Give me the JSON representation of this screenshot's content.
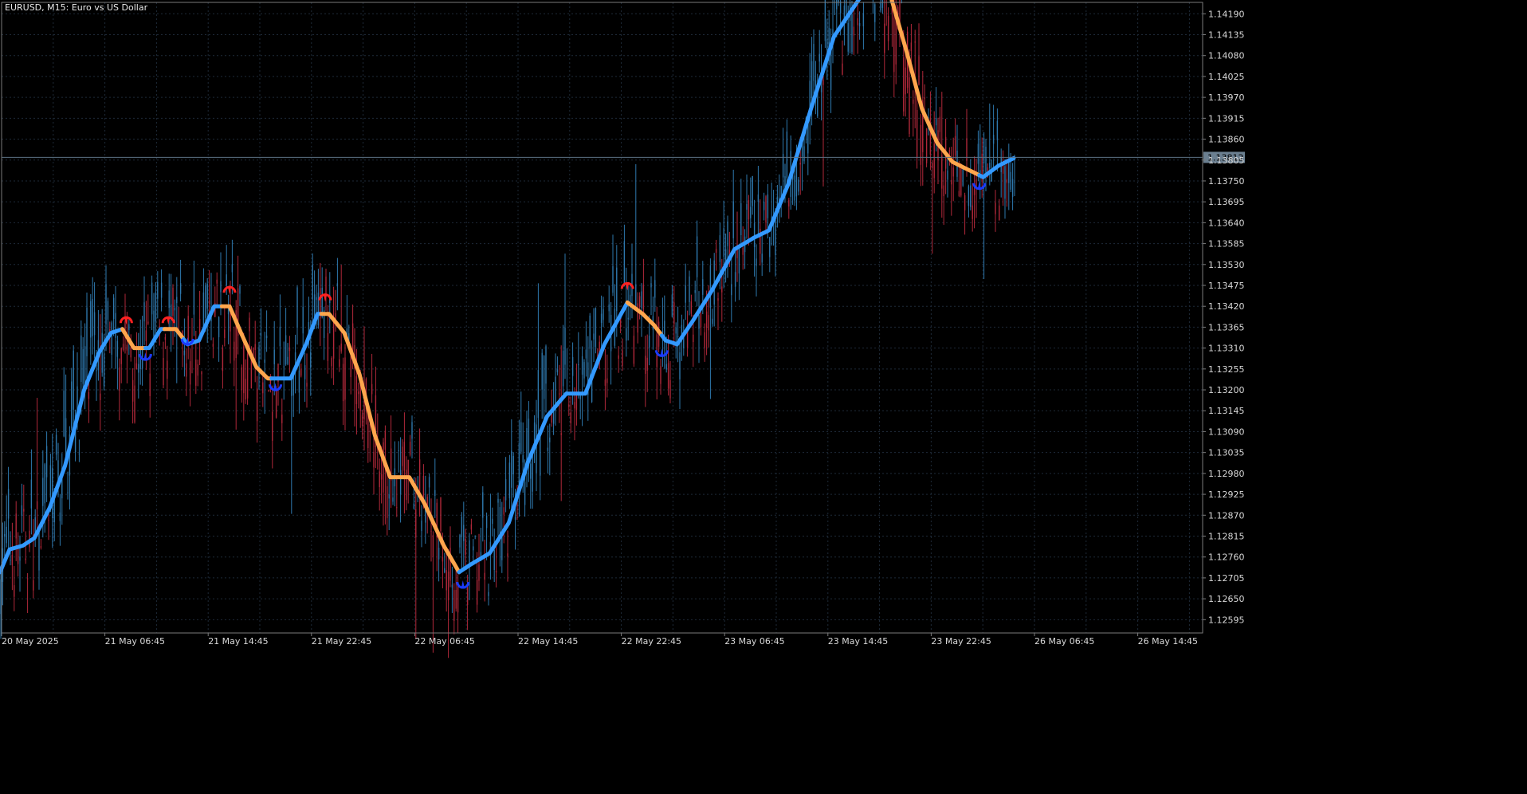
{
  "window": {
    "title": "EURUSD, M15:  Euro vs US Dollar"
  },
  "colors": {
    "background": "#000000",
    "grid": "#1e2a38",
    "frame": "#7a7a7a",
    "bull_candle": "#2e78ad",
    "bear_candle": "#b0283a",
    "trend_up": "#3399ff",
    "trend_down": "#ffa64d",
    "signal_buy": "#1a3cff",
    "signal_sell": "#ff2222",
    "bid_line": "#5c7285",
    "price_label_bg": "#6b7f90",
    "text": "#d9d9d9"
  },
  "chart_data": {
    "type": "candlestick",
    "symbol": "EURUSD",
    "timeframe": "M15",
    "ylim": [
      1.1256,
      1.1422
    ],
    "yticks": [
      1.12595,
      1.1265,
      1.12705,
      1.1276,
      1.12815,
      1.1287,
      1.12925,
      1.1298,
      1.13035,
      1.1309,
      1.13145,
      1.132,
      1.13255,
      1.1331,
      1.13365,
      1.1342,
      1.13475,
      1.1353,
      1.13585,
      1.1364,
      1.13695,
      1.1375,
      1.13805,
      1.1386,
      1.13915,
      1.1397,
      1.14025,
      1.1408,
      1.14135,
      1.1419
    ],
    "ytick_labels": [
      "1.12595",
      "1.12650",
      "1.12705",
      "1.12760",
      "1.12815",
      "1.12870",
      "1.12925",
      "1.12980",
      "1.13035",
      "1.13090",
      "1.13145",
      "1.13200",
      "1.13255",
      "1.13310",
      "1.13365",
      "1.13420",
      "1.13475",
      "1.13530",
      "1.13585",
      "1.13640",
      "1.13695",
      "1.13750",
      "1.13805",
      "1.13860",
      "1.13915",
      "1.13970",
      "1.14025",
      "1.14080",
      "1.14135",
      "1.14190"
    ],
    "x_labels": [
      "20 May 2025",
      "21 May 06:45",
      "21 May 14:45",
      "21 May 22:45",
      "22 May 06:45",
      "22 May 14:45",
      "22 May 22:45",
      "23 May 06:45",
      "23 May 14:45",
      "23 May 22:45",
      "26 May 06:45",
      "26 May 14:45"
    ],
    "bars_per_label": 32,
    "bar_count": 390,
    "current_price": 1.13812,
    "current_price_label": "1.13812",
    "grid": true,
    "trend_line": {
      "name": "",
      "knots": [
        [
          0,
          1.1272
        ],
        [
          5,
          1.1278
        ],
        [
          12,
          1.1279
        ],
        [
          18,
          1.1281
        ],
        [
          26,
          1.1289
        ],
        [
          34,
          1.13
        ],
        [
          44,
          1.132
        ],
        [
          52,
          1.133
        ],
        [
          58,
          1.1335
        ],
        [
          64,
          1.1336
        ],
        [
          70,
          1.1331
        ],
        [
          78,
          1.1331
        ],
        [
          84,
          1.1336
        ],
        [
          92,
          1.1336
        ],
        [
          98,
          1.1332
        ],
        [
          104,
          1.1333
        ],
        [
          112,
          1.1342
        ],
        [
          120,
          1.1342
        ],
        [
          126,
          1.1335
        ],
        [
          134,
          1.1326
        ],
        [
          140,
          1.1323
        ],
        [
          152,
          1.1323
        ],
        [
          160,
          1.1332
        ],
        [
          166,
          1.134
        ],
        [
          172,
          1.134
        ],
        [
          180,
          1.1335
        ],
        [
          188,
          1.1324
        ],
        [
          196,
          1.1308
        ],
        [
          204,
          1.1297
        ],
        [
          214,
          1.1297
        ],
        [
          222,
          1.129
        ],
        [
          232,
          1.1279
        ],
        [
          240,
          1.1272
        ],
        [
          246,
          1.1274
        ],
        [
          256,
          1.1277
        ],
        [
          266,
          1.1285
        ],
        [
          276,
          1.1301
        ],
        [
          286,
          1.1313
        ],
        [
          296,
          1.1319
        ],
        [
          306,
          1.1319
        ],
        [
          316,
          1.1332
        ],
        [
          328,
          1.1343
        ],
        [
          336,
          1.134
        ],
        [
          342,
          1.1337
        ],
        [
          348,
          1.1333
        ],
        [
          354,
          1.1332
        ],
        [
          362,
          1.1338
        ],
        [
          372,
          1.1346
        ],
        [
          384,
          1.1357
        ],
        [
          394,
          1.136
        ],
        [
          402,
          1.1362
        ],
        [
          412,
          1.1374
        ],
        [
          424,
          1.1394
        ],
        [
          436,
          1.1413
        ],
        [
          452,
          1.1425
        ],
        [
          458,
          1.1427
        ],
        [
          466,
          1.1423
        ],
        [
          474,
          1.1409
        ],
        [
          482,
          1.1394
        ],
        [
          490,
          1.1385
        ],
        [
          498,
          1.138
        ],
        [
          506,
          1.1378
        ],
        [
          514,
          1.1376
        ],
        [
          522,
          1.1379
        ],
        [
          530,
          1.1381
        ]
      ]
    },
    "trend_segments": [
      {
        "from": 0,
        "to": 64,
        "direction": "up"
      },
      {
        "from": 64,
        "to": 76,
        "direction": "down"
      },
      {
        "from": 76,
        "to": 86,
        "direction": "up"
      },
      {
        "from": 86,
        "to": 96,
        "direction": "down"
      },
      {
        "from": 96,
        "to": 116,
        "direction": "up"
      },
      {
        "from": 116,
        "to": 142,
        "direction": "down"
      },
      {
        "from": 142,
        "to": 168,
        "direction": "up"
      },
      {
        "from": 168,
        "to": 240,
        "direction": "down"
      },
      {
        "from": 240,
        "to": 328,
        "direction": "up"
      },
      {
        "from": 328,
        "to": 346,
        "direction": "down"
      },
      {
        "from": 346,
        "to": 458,
        "direction": "up"
      },
      {
        "from": 458,
        "to": 512,
        "direction": "down"
      },
      {
        "from": 512,
        "to": 530,
        "direction": "up"
      }
    ],
    "signals": [
      {
        "bar": 66,
        "type": "sell",
        "price": 1.1338
      },
      {
        "bar": 76,
        "type": "buy",
        "price": 1.1329
      },
      {
        "bar": 88,
        "type": "sell",
        "price": 1.1338
      },
      {
        "bar": 98,
        "type": "buy",
        "price": 1.1333
      },
      {
        "bar": 120,
        "type": "sell",
        "price": 1.1346
      },
      {
        "bar": 144,
        "type": "buy",
        "price": 1.1321
      },
      {
        "bar": 170,
        "type": "sell",
        "price": 1.1344
      },
      {
        "bar": 242,
        "type": "buy",
        "price": 1.1269
      },
      {
        "bar": 328,
        "type": "sell",
        "price": 1.1347
      },
      {
        "bar": 346,
        "type": "buy",
        "price": 1.133
      },
      {
        "bar": 458,
        "type": "sell",
        "price": 1.1431
      },
      {
        "bar": 512,
        "type": "buy",
        "price": 1.1374
      }
    ]
  }
}
